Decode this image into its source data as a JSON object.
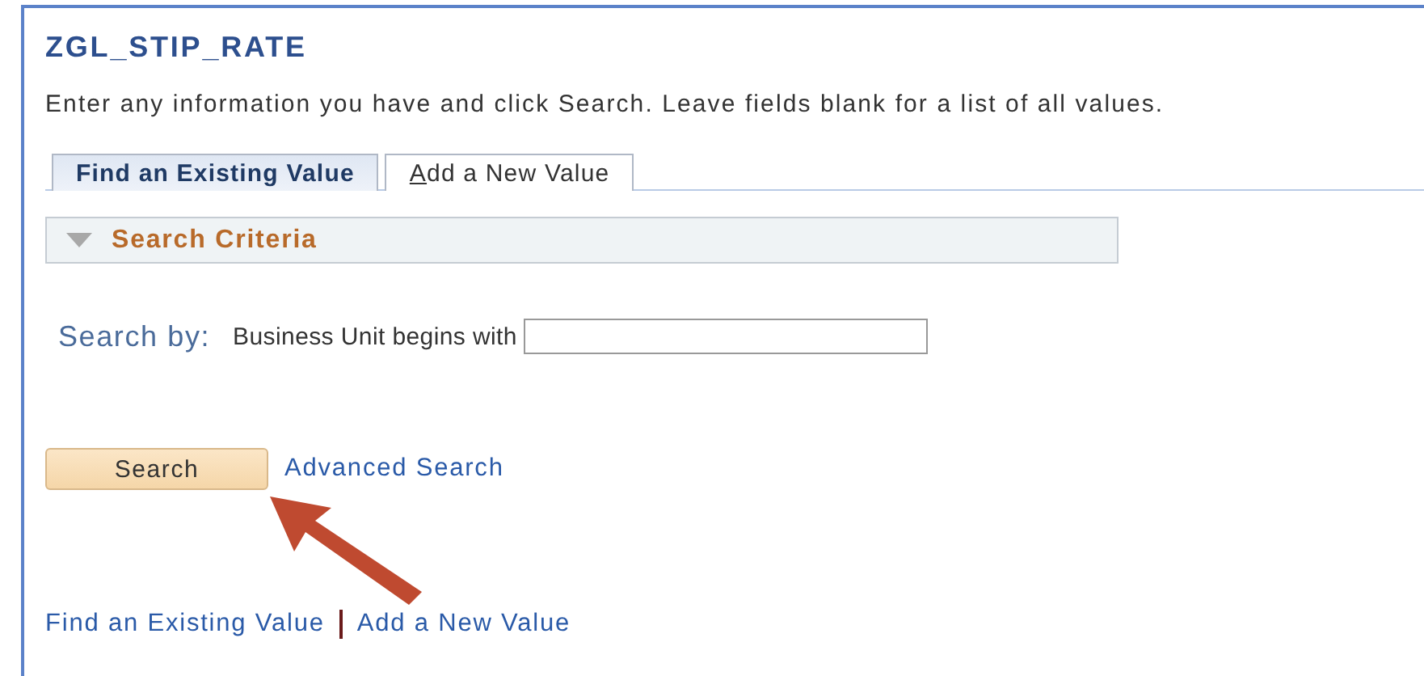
{
  "page": {
    "title": "ZGL_STIP_RATE",
    "instructions": "Enter any information you have and click Search. Leave fields blank for a list of all values."
  },
  "tabs": [
    {
      "label": "Find an Existing Value",
      "selected": true
    },
    {
      "label": "Add a New Value",
      "selected": false
    }
  ],
  "search_criteria": {
    "label": "Search Criteria",
    "expanded": true,
    "search_by": "Search by:",
    "field_label": "Business Unit begins with"
  },
  "buttons": {
    "search": "Search",
    "advanced_search": "Advanced Search"
  },
  "footer_links": [
    "Find an Existing Value",
    "Add a New Value"
  ]
}
